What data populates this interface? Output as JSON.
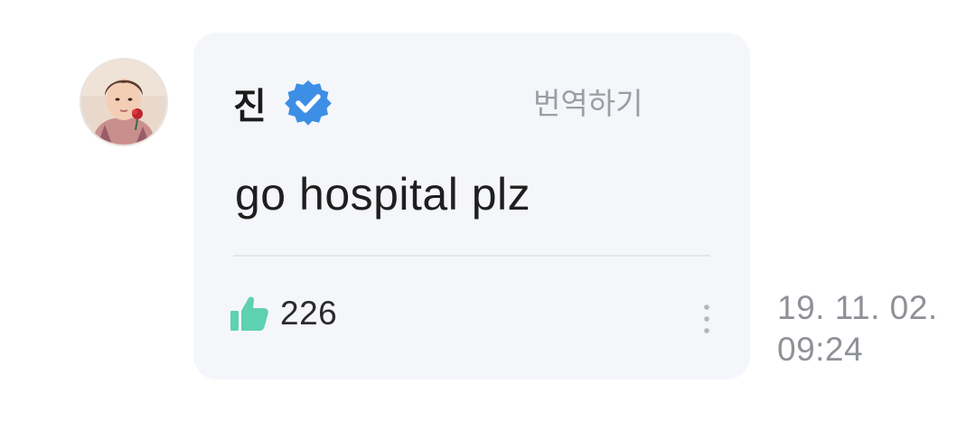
{
  "post": {
    "author": "진",
    "verified": true,
    "translate_label": "번역하기",
    "message": "go hospital plz",
    "likes": "226",
    "date": "19. 11. 02.",
    "time": "09:24"
  },
  "icons": {
    "verified": "verified-badge-icon",
    "like": "thumbs-up-icon",
    "more": "vertical-ellipsis-icon"
  },
  "colors": {
    "card_background": "#f4f6f9",
    "verified_badge": "#3d8fe6",
    "like_icon": "#5fd1b3",
    "secondary_text": "#8e9196"
  }
}
